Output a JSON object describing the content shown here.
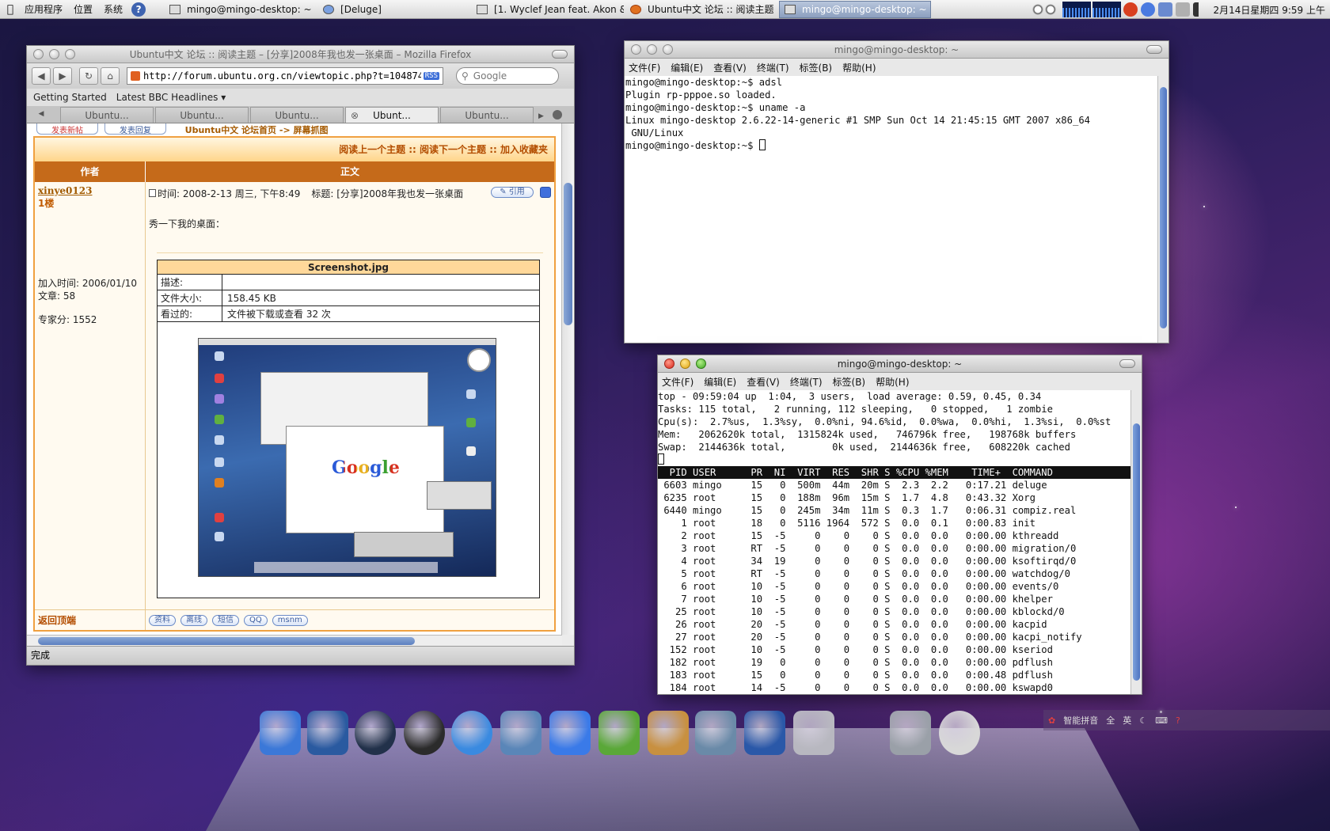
{
  "top_panel": {
    "menus": [
      "应用程序",
      "位置",
      "系统"
    ],
    "tasks": [
      {
        "label": "mingo@mingo-desktop: ~",
        "active": false
      },
      {
        "label": "[Deluge]",
        "active": false
      },
      {
        "label": "[1. Wyclef Jean feat. Akon &...",
        "active": false
      },
      {
        "label": "Ubuntu中文 论坛 :: 阅读主题 ...",
        "active": false
      },
      {
        "label": "mingo@mingo-desktop: ~",
        "active": true
      }
    ],
    "clock": "2月14日星期四  9:59 上午"
  },
  "firefox": {
    "title": "Ubuntu中文 论坛 :: 阅读主题 – [分享]2008年我也发一张桌面 – Mozilla Firefox",
    "url": "http://forum.ubuntu.org.cn/viewtopic.php?t=104874",
    "rss": "RSS",
    "search_placeholder": "Google",
    "bookmarks": [
      "Getting Started",
      "Latest BBC Headlines ▾"
    ],
    "tabs": [
      "Ubuntu...",
      "Ubuntu...",
      "Ubuntu...",
      "Ubunt...",
      "Ubuntu..."
    ],
    "status": "完成",
    "page": {
      "top_buttons": [
        "发表新帖",
        "发表回复"
      ],
      "breadcrumb": "Ubuntu中文 论坛首页  -> 屏幕抓图",
      "topic_nav": "阅读上一个主题 :: 阅读下一个主题 :: 加入收藏夹",
      "col_author": "作者",
      "col_body": "正文",
      "author": {
        "name": "xinye0123",
        "floor": "1楼",
        "joined": "加入时间: 2006/01/10",
        "posts": "文章: 58",
        "points": "专家分: 1552"
      },
      "post_time": "时间: 2008-2-13 周三, 下午8:49",
      "post_subject": "标题: [分享]2008年我也发一张桌面",
      "quote": "引用",
      "body_text": "秀一下我的桌面：",
      "attachment": {
        "filename": "Screenshot.jpg",
        "rows": [
          {
            "key": "描述:",
            "value": ""
          },
          {
            "key": "文件大小:",
            "value": "158.45 KB"
          },
          {
            "key": "看过的:",
            "value": "文件被下载或查看 32 次"
          }
        ],
        "thumb_logo": "Google"
      },
      "back_to_top": "返回顶端",
      "profile_buttons": [
        "资料",
        "离线",
        "短信",
        "QQ",
        "msnm"
      ]
    }
  },
  "term1": {
    "title": "mingo@mingo-desktop: ~",
    "menu": [
      "文件(F)",
      "编辑(E)",
      "查看(V)",
      "终端(T)",
      "标签(B)",
      "帮助(H)"
    ],
    "lines": [
      "mingo@mingo-desktop:~$ adsl",
      "Plugin rp-pppoe.so loaded.",
      "mingo@mingo-desktop:~$ uname -a",
      "Linux mingo-desktop 2.6.22-14-generic #1 SMP Sun Oct 14 21:45:15 GMT 2007 x86_64",
      " GNU/Linux"
    ],
    "prompt": "mingo@mingo-desktop:~$ "
  },
  "term2": {
    "title": "mingo@mingo-desktop: ~",
    "menu": [
      "文件(F)",
      "编辑(E)",
      "查看(V)",
      "终端(T)",
      "标签(B)",
      "帮助(H)"
    ],
    "summary": [
      "top - 09:59:04 up  1:04,  3 users,  load average: 0.59, 0.45, 0.34",
      "Tasks: 115 total,   2 running, 112 sleeping,   0 stopped,   1 zombie",
      "Cpu(s):  2.7%us,  1.3%sy,  0.0%ni, 94.6%id,  0.0%wa,  0.0%hi,  1.3%si,  0.0%st",
      "Mem:   2062620k total,  1315824k used,   746796k free,   198768k buffers",
      "Swap:  2144636k total,        0k used,  2144636k free,   608220k cached"
    ],
    "header": "  PID USER      PR  NI  VIRT  RES  SHR S %CPU %MEM    TIME+  COMMAND",
    "procs": [
      " 6603 mingo     15   0  500m  44m  20m S  2.3  2.2   0:17.21 deluge",
      " 6235 root      15   0  188m  96m  15m S  1.7  4.8   0:43.32 Xorg",
      " 6440 mingo     15   0  245m  34m  11m S  0.3  1.7   0:06.31 compiz.real",
      "    1 root      18   0  5116 1964  572 S  0.0  0.1   0:00.83 init",
      "    2 root      15  -5     0    0    0 S  0.0  0.0   0:00.00 kthreadd",
      "    3 root      RT  -5     0    0    0 S  0.0  0.0   0:00.00 migration/0",
      "    4 root      34  19     0    0    0 S  0.0  0.0   0:00.00 ksoftirqd/0",
      "    5 root      RT  -5     0    0    0 S  0.0  0.0   0:00.00 watchdog/0",
      "    6 root      10  -5     0    0    0 S  0.0  0.0   0:00.00 events/0",
      "    7 root      10  -5     0    0    0 S  0.0  0.0   0:00.00 khelper",
      "   25 root      10  -5     0    0    0 S  0.0  0.0   0:00.00 kblockd/0",
      "   26 root      20  -5     0    0    0 S  0.0  0.0   0:00.00 kacpid",
      "   27 root      20  -5     0    0    0 S  0.0  0.0   0:00.00 kacpi_notify",
      "  152 root      10  -5     0    0    0 S  0.0  0.0   0:00.00 kseriod",
      "  182 root      19   0     0    0    0 S  0.0  0.0   0:00.00 pdflush",
      "  183 root      15   0     0    0    0 S  0.0  0.0   0:00.48 pdflush",
      "  184 root      14  -5     0    0    0 S  0.0  0.0   0:00.00 kswapd0"
    ]
  },
  "dock": {
    "icons": [
      {
        "name": "finder-icon",
        "color": "#3b78d8"
      },
      {
        "name": "spaces-icon",
        "color": "#2a5aa0"
      },
      {
        "name": "time-machine-icon",
        "color": "#22314a"
      },
      {
        "name": "dashboard-icon",
        "color": "#2b2b2b"
      },
      {
        "name": "safari-icon",
        "color": "#3a8ae0"
      },
      {
        "name": "mail-stamp-icon",
        "color": "#5a86b8"
      },
      {
        "name": "ichat-icon",
        "color": "#3a7ae8"
      },
      {
        "name": "itunes-icon",
        "color": "#5aa838"
      },
      {
        "name": "iphoto-icon",
        "color": "#c89040"
      },
      {
        "name": "photo-booth-icon",
        "color": "#6a8aa8"
      },
      {
        "name": "imovie-icon",
        "color": "#2a58a8"
      },
      {
        "name": "mail-at-icon",
        "color": "#b8b8c0"
      },
      {
        "name": "trash-icon",
        "color": "#9aa0a8"
      },
      {
        "name": "clock-icon",
        "color": "#d8d8d8"
      }
    ]
  },
  "ime": {
    "labels": [
      "智能拼音",
      "全",
      "英"
    ]
  }
}
